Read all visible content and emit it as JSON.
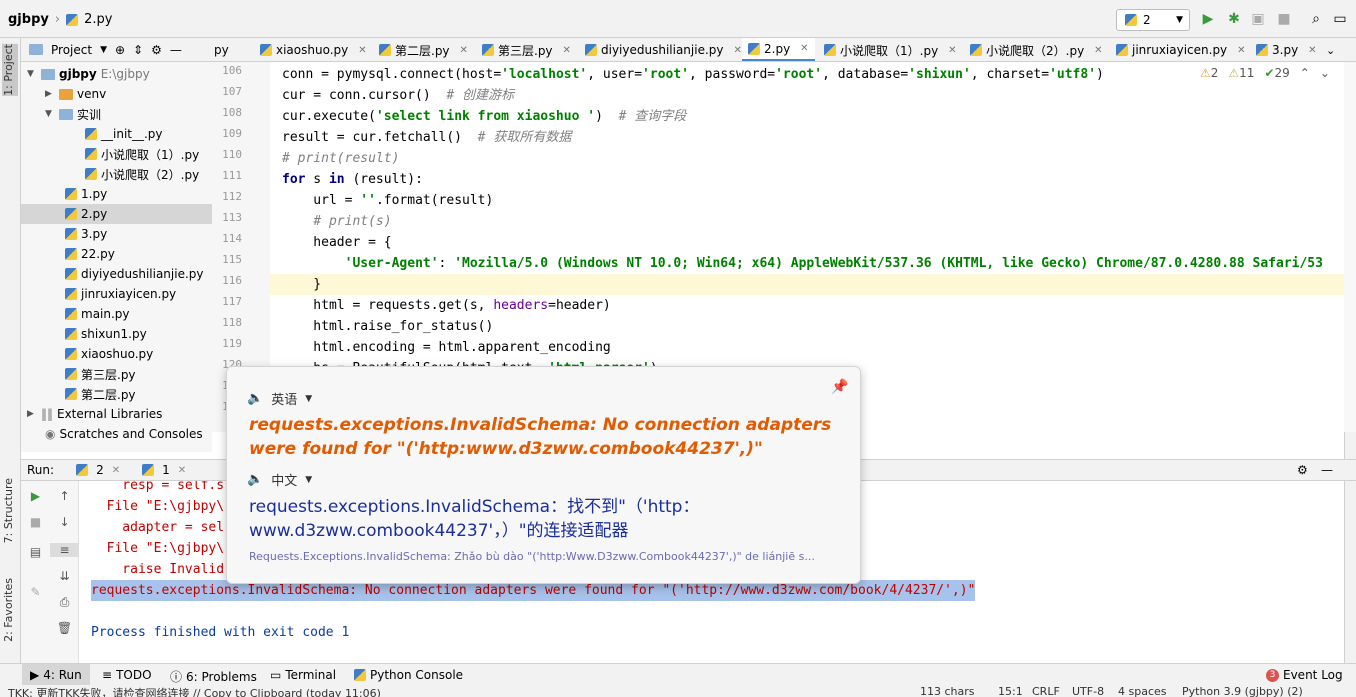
{
  "navbar": {
    "project": "gjbpy",
    "file": "2.py",
    "run_config": "2"
  },
  "project_panel": {
    "title": "Project",
    "tree": [
      {
        "label": "gjbpy",
        "path": "E:\\gjbpy"
      },
      {
        "label": "venv"
      },
      {
        "label": "实训"
      },
      {
        "label": "__init__.py"
      },
      {
        "label": "小说爬取（1）.py"
      },
      {
        "label": "小说爬取（2）.py"
      },
      {
        "label": "1.py"
      },
      {
        "label": "2.py"
      },
      {
        "label": "3.py"
      },
      {
        "label": "22.py"
      },
      {
        "label": "diyiyedushilianjie.py"
      },
      {
        "label": "jinruxiayicen.py"
      },
      {
        "label": "main.py"
      },
      {
        "label": "shixun1.py"
      },
      {
        "label": "xiaoshuo.py"
      },
      {
        "label": "第三层.py"
      },
      {
        "label": "第二层.py"
      },
      {
        "label": "External Libraries"
      },
      {
        "label": "Scratches and Consoles"
      }
    ]
  },
  "left_strip": {
    "project": "1: Project",
    "structure": "7: Structure",
    "favorites": "2: Favorites"
  },
  "tabs": [
    {
      "label": "py"
    },
    {
      "label": "xiaoshuo.py"
    },
    {
      "label": "第二层.py"
    },
    {
      "label": "第三层.py"
    },
    {
      "label": "diyiyedushilianjie.py"
    },
    {
      "label": "2.py"
    },
    {
      "label": "小说爬取（1）.py"
    },
    {
      "label": "小说爬取（2）.py"
    },
    {
      "label": "jinruxiayicen.py"
    },
    {
      "label": "3.py"
    }
  ],
  "inspections": {
    "warnings": "2",
    "weak": "11",
    "ok": "29"
  },
  "editor": {
    "line_numbers": [
      "106",
      "107",
      "108",
      "109",
      "110",
      "111",
      "112",
      "113",
      "114",
      "115",
      "116",
      "117",
      "118",
      "119",
      "120",
      "121",
      "122"
    ],
    "lines": [
      {
        "parts": [
          {
            "t": "conn = pymysql.connect(host="
          },
          {
            "t": "'localhost'",
            "c": "st"
          },
          {
            "t": ", user="
          },
          {
            "t": "'root'",
            "c": "st"
          },
          {
            "t": ", password="
          },
          {
            "t": "'root'",
            "c": "st"
          },
          {
            "t": ", database="
          },
          {
            "t": "'shixun'",
            "c": "st"
          },
          {
            "t": ", charset="
          },
          {
            "t": "'utf8'",
            "c": "st"
          },
          {
            "t": ")"
          }
        ]
      },
      {
        "parts": [
          {
            "t": "cur = conn.cursor()  "
          },
          {
            "t": "# 创建游标",
            "c": "cm"
          }
        ]
      },
      {
        "parts": [
          {
            "t": "cur.execute("
          },
          {
            "t": "'select link from xiaoshuo '",
            "c": "st"
          },
          {
            "t": ")  "
          },
          {
            "t": "# 查询字段",
            "c": "cm"
          }
        ]
      },
      {
        "parts": [
          {
            "t": "result = cur.fetchall()  "
          },
          {
            "t": "# 获取所有数据",
            "c": "cm"
          }
        ]
      },
      {
        "parts": [
          {
            "t": "# print(result)",
            "c": "cm"
          }
        ]
      },
      {
        "parts": [
          {
            "t": "for",
            "c": "kw"
          },
          {
            "t": " s "
          },
          {
            "t": "in",
            "c": "kw"
          },
          {
            "t": " (result):"
          }
        ]
      },
      {
        "parts": [
          {
            "t": "    url = "
          },
          {
            "t": "''",
            "c": "st"
          },
          {
            "t": ".format(result)"
          }
        ]
      },
      {
        "parts": [
          {
            "t": "    "
          },
          {
            "t": "# print(s)",
            "c": "cm"
          }
        ]
      },
      {
        "parts": [
          {
            "t": "    header = {"
          }
        ]
      },
      {
        "parts": [
          {
            "t": "        "
          },
          {
            "t": "'User-Agent'",
            "c": "st"
          },
          {
            "t": ": "
          },
          {
            "t": "'Mozilla/5.0 (Windows NT 10.0; Win64; x64) AppleWebKit/537.36 (KHTML, like Gecko) Chrome/87.0.4280.88 Safari/53",
            "c": "st"
          }
        ]
      },
      {
        "parts": [
          {
            "t": "    }"
          }
        ]
      },
      {
        "parts": [
          {
            "t": "    html = requests.get(s, "
          },
          {
            "t": "headers",
            "c": "pm"
          },
          {
            "t": "=header)"
          }
        ]
      },
      {
        "parts": [
          {
            "t": "    html.raise_for_status()"
          }
        ]
      },
      {
        "parts": [
          {
            "t": "    html.encoding = html.apparent_encoding"
          }
        ]
      },
      {
        "parts": [
          {
            "t": "    bs = BeautifulSoup(html.text, "
          },
          {
            "t": "'html.parser'",
            "c": "st"
          },
          {
            "t": ")"
          }
        ]
      }
    ]
  },
  "run_panel": {
    "label": "Run:",
    "tab1": "2",
    "tab2": "1",
    "console_lines": [
      "    resp = self.s",
      "  File \"E:\\gjbpy\\",
      "    adapter = sel",
      "  File \"E:\\gjbpy\\",
      "    raise Invalid",
      "requests.exceptions.InvalidSchema: No connection adapters were found for \"('http://www.d3zww.com/book/4/4237/',)\"",
      "",
      "Process finished with exit code 1"
    ]
  },
  "translation_popup": {
    "source_lang": "英语",
    "source_text": "requests.exceptions.InvalidSchema: No connection adapters were found for \"('http:www.d3zww.combook44237',)\"",
    "target_lang": "中文",
    "target_text": "requests.exceptions.InvalidSchema：找不到\"（'http：www.d3zww.combook44237'，）\"的连接适配器",
    "pinyin": "Requests.Exceptions.InvalidSchema: Zhǎo bù dào \"('http:Www.D3zww.Combook44237',)\" de liánjiē s..."
  },
  "bottom_tabs": [
    {
      "label": "4: Run"
    },
    {
      "label": "TODO"
    },
    {
      "label": "6: Problems"
    },
    {
      "label": "Terminal"
    },
    {
      "label": "Python Console"
    },
    {
      "label": "Event Log"
    }
  ],
  "event_log_count": "3",
  "status": {
    "message": "TKK: 更新TKK失败，请检查网络连接 // Copy to Clipboard (today 11:06)",
    "chars": "113 chars",
    "pos": "15:1",
    "eol": "CRLF",
    "enc": "UTF-8",
    "indent": "4 spaces",
    "interp": "Python 3.9 (gjbpy) (2)"
  },
  "colors": {
    "accent": "#4a86c8",
    "error": "#c00000",
    "orange": "#e35a00",
    "translation": "#1a2e9c"
  }
}
